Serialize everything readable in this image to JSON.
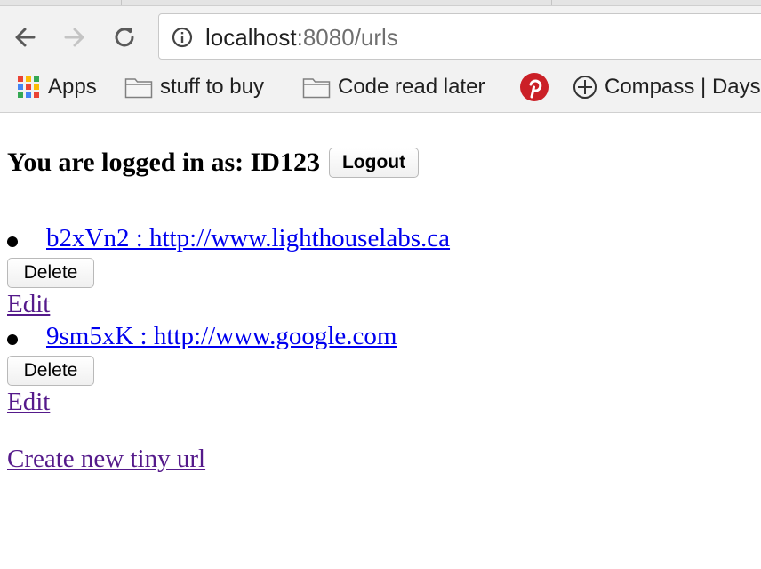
{
  "browser": {
    "url_host": "localhost",
    "url_rest": ":8080/urls",
    "bookmarks": [
      {
        "label": "Apps",
        "icon": "apps-grid-icon"
      },
      {
        "label": "stuff to buy",
        "icon": "folder-icon"
      },
      {
        "label": "Code read later",
        "icon": "folder-icon"
      },
      {
        "label": "",
        "icon": "pinterest-icon"
      },
      {
        "label": "Compass | Days",
        "icon": "compass-icon"
      }
    ]
  },
  "page": {
    "login_text": "You are logged in as: ID123",
    "logout_label": "Logout",
    "urls": [
      {
        "link": "b2xVn2 : http://www.lighthouselabs.ca",
        "delete_label": "Delete",
        "edit_label": "Edit"
      },
      {
        "link": "9sm5xK : http://www.google.com",
        "delete_label": "Delete",
        "edit_label": "Edit"
      }
    ],
    "create_label": "Create new tiny url"
  },
  "colors": {
    "link": "#0000ee",
    "visited_link": "#551a8b",
    "pinterest": "#cb2027"
  }
}
